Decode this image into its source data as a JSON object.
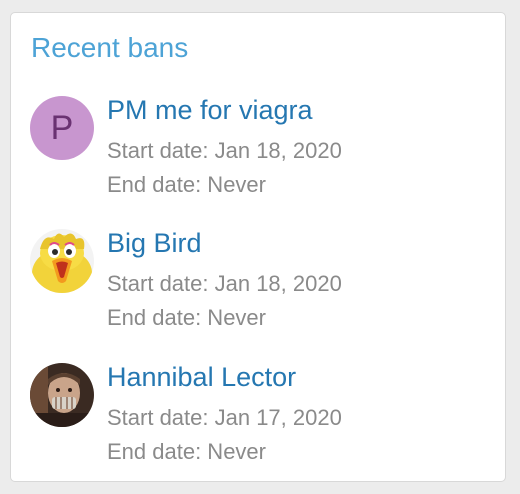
{
  "widget": {
    "title": "Recent bans"
  },
  "bans": [
    {
      "name": "PM me for viagra",
      "avatar_letter": "P",
      "start": "Start date: Jan 18, 2020",
      "end": "End date: Never"
    },
    {
      "name": "Big Bird",
      "start": "Start date: Jan 18, 2020",
      "end": "End date: Never"
    },
    {
      "name": "Hannibal Lector",
      "start": "Start date: Jan 17, 2020",
      "end": "End date: Never"
    }
  ],
  "colors": {
    "title": "#4da3d6",
    "link": "#2577b1",
    "meta": "#8a8a8a",
    "avatar_letter_bg": "#c896cf"
  }
}
